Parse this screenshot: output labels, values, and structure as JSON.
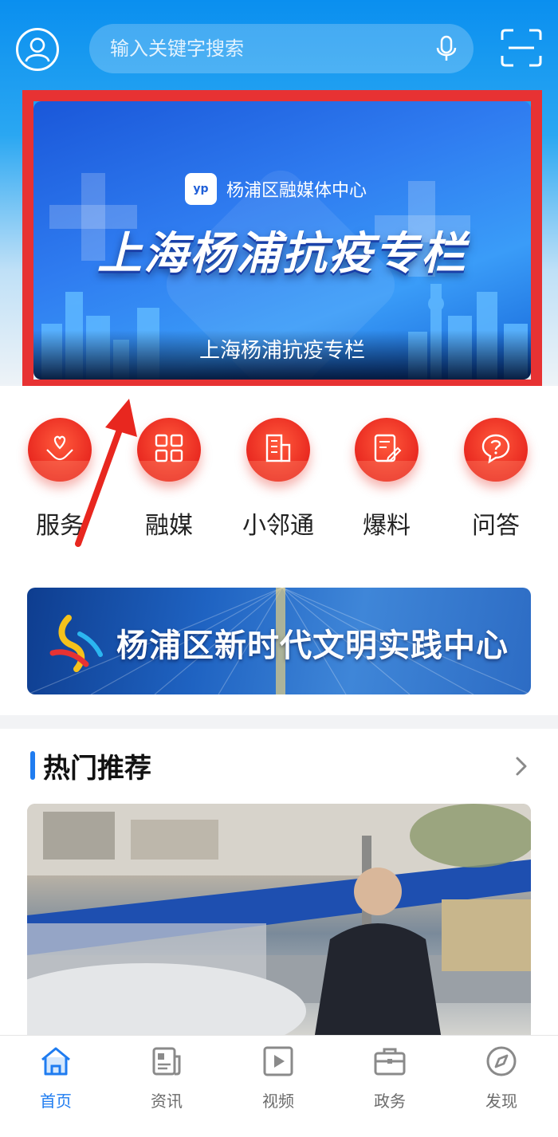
{
  "header": {
    "search_placeholder": "输入关键字搜索"
  },
  "banner": {
    "brand": "杨浦区融媒体中心",
    "headline": "上海杨浦抗疫专栏",
    "caption": "上海杨浦抗疫专栏"
  },
  "quick_links": [
    {
      "label": "服务",
      "icon": "heart-hands-icon"
    },
    {
      "label": "融媒",
      "icon": "grid-icon"
    },
    {
      "label": "小邻通",
      "icon": "building-icon"
    },
    {
      "label": "爆料",
      "icon": "edit-note-icon"
    },
    {
      "label": "问答",
      "icon": "question-icon"
    }
  ],
  "civ_banner": {
    "text": "杨浦区新时代文明实践中心"
  },
  "hot": {
    "title": "热门推荐"
  },
  "tabs": [
    {
      "label": "首页",
      "icon": "home-icon",
      "active": true
    },
    {
      "label": "资讯",
      "icon": "news-icon",
      "active": false
    },
    {
      "label": "视频",
      "icon": "video-icon",
      "active": false
    },
    {
      "label": "政务",
      "icon": "briefcase-icon",
      "active": false
    },
    {
      "label": "发现",
      "icon": "compass-icon",
      "active": false
    }
  ],
  "colors": {
    "accent": "#1f7cf0",
    "highlight_frame": "#e73233",
    "quick_icon_red": "#e8271f"
  }
}
